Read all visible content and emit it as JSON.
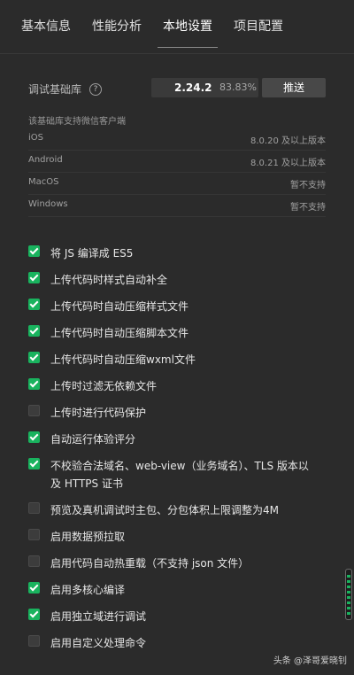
{
  "tabs": [
    {
      "label": "基本信息"
    },
    {
      "label": "性能分析"
    },
    {
      "label": "本地设置"
    },
    {
      "label": "项目配置"
    }
  ],
  "base_lib": {
    "label": "调试基础库",
    "help_icon": "question-circle-icon",
    "version": "2.24.2",
    "percent": "83.83%",
    "push_label": "推送"
  },
  "support": {
    "title": "该基础库支持微信客户端",
    "platforms": [
      {
        "name": "iOS",
        "value": "8.0.20 及以上版本"
      },
      {
        "name": "Android",
        "value": "8.0.21 及以上版本"
      },
      {
        "name": "MacOS",
        "value": "暂不支持"
      },
      {
        "name": "Windows",
        "value": "暂不支持"
      }
    ]
  },
  "options": [
    {
      "label": "将 JS 编译成 ES5",
      "checked": true
    },
    {
      "label": "上传代码时样式自动补全",
      "checked": true
    },
    {
      "label": "上传代码时自动压缩样式文件",
      "checked": true
    },
    {
      "label": "上传代码时自动压缩脚本文件",
      "checked": true
    },
    {
      "label": "上传代码时自动压缩wxml文件",
      "checked": true
    },
    {
      "label": "上传时过滤无依赖文件",
      "checked": true
    },
    {
      "label": "上传时进行代码保护",
      "checked": false
    },
    {
      "label": "自动运行体验评分",
      "checked": true
    },
    {
      "label": "不校验合法域名、web-view（业务域名）、TLS 版本以及 HTTPS 证书",
      "checked": true
    },
    {
      "label": "预览及真机调试时主包、分包体积上限调整为4M",
      "checked": false
    },
    {
      "label": "启用数据预拉取",
      "checked": false
    },
    {
      "label": "启用代码自动热重载（不支持 json 文件）",
      "checked": false
    },
    {
      "label": "启用多核心编译",
      "checked": true
    },
    {
      "label": "启用独立域进行调试",
      "checked": true
    },
    {
      "label": "启用自定义处理命令",
      "checked": false
    }
  ],
  "colors": {
    "accent": "#19b35e",
    "background": "#2b2b2b"
  },
  "watermark": "头条 @泽哥爱晓钊"
}
